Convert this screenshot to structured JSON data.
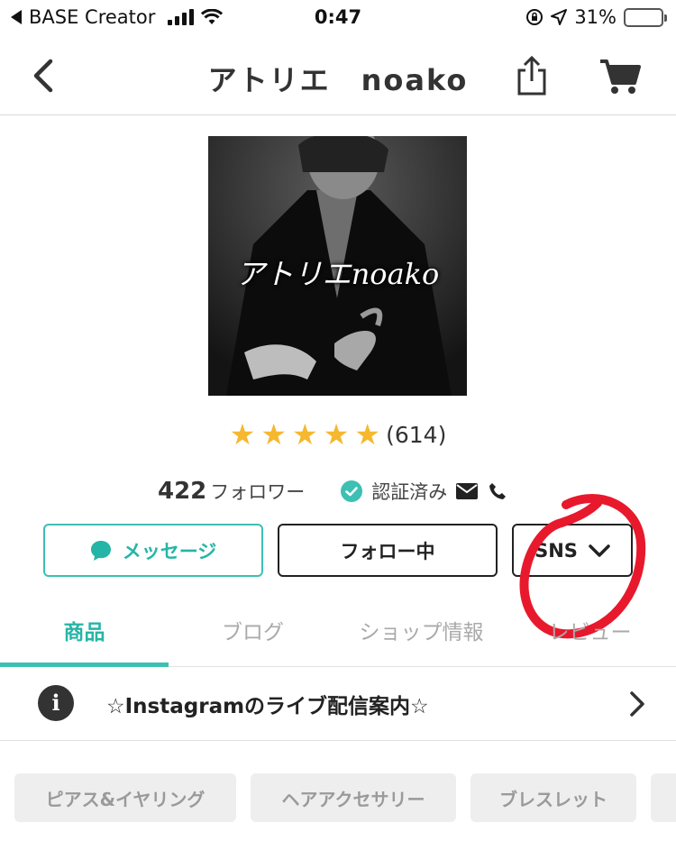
{
  "status_bar": {
    "carrier": "BASE Creator",
    "time": "0:47",
    "battery_percent": "31%",
    "battery_level": 0.31
  },
  "navbar": {
    "title": "アトリエ　noako"
  },
  "shop": {
    "logo_text": "アトリエnoako",
    "rating_stars": 5,
    "review_count": "(614)",
    "follower_count": "422",
    "follower_label": "フォロワー",
    "verified_label": "認証済み"
  },
  "actions": {
    "message_label": "メッセージ",
    "follow_label": "フォロー中",
    "sns_label": "SNS"
  },
  "tabs": [
    {
      "label": "商品",
      "active": true
    },
    {
      "label": "ブログ",
      "active": false
    },
    {
      "label": "ショップ情報",
      "active": false
    },
    {
      "label": "レビュー",
      "active": false
    }
  ],
  "notice": {
    "text": "☆Instagramのライブ配信案内☆"
  },
  "categories": [
    {
      "label": "ピアス&イヤリング"
    },
    {
      "label": "ヘアアクセサリー"
    },
    {
      "label": "ブレスレット"
    }
  ],
  "colors": {
    "accent": "#3cc0b3",
    "star": "#f5b82e",
    "annotation": "#e8192c"
  }
}
